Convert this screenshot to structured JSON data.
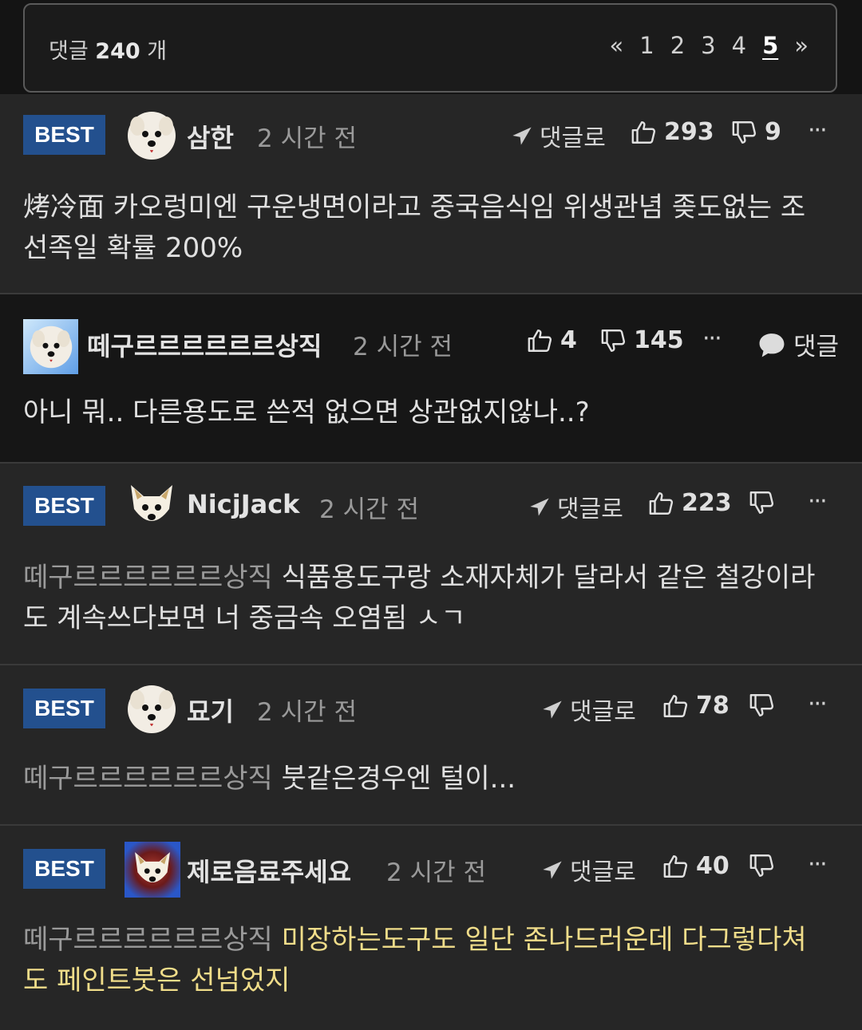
{
  "header": {
    "count_prefix": "댓글",
    "count_value": "240",
    "count_suffix": "개",
    "pager": {
      "prev": "«",
      "pages": [
        "1",
        "2",
        "3",
        "4",
        "5"
      ],
      "current": "5",
      "next": "»"
    }
  },
  "comments": [
    {
      "badge": "BEST",
      "username": "삼한",
      "time": "2 시간 전",
      "reply_label": "댓글로",
      "likes": "293",
      "dislikes": "9",
      "more": "···",
      "mention": "",
      "text": "烤冷面 카오렁미엔 구운냉면이라고 중국음식임 위생관념 좆도없는 조선족일 확률 200%"
    },
    {
      "username": "떼구르르르르르르상직",
      "time": "2 시간 전",
      "likes": "4",
      "dislikes": "145",
      "more": "···",
      "reply_label": "댓글",
      "text": "아니 뭐.. 다른용도로 쓴적 없으면 상관없지않나..?"
    },
    {
      "badge": "BEST",
      "username": "NicjJack",
      "time": "2 시간 전",
      "reply_label": "댓글로",
      "likes": "223",
      "dislikes": "",
      "more": "···",
      "mention": "떼구르르르르르르상직",
      "text": "식품용도구랑 소재자체가 달라서 같은 철강이라도 계속쓰다보면 너 중금속 오염됨 ㅅㄱ"
    },
    {
      "badge": "BEST",
      "username": "묘기",
      "time": "2 시간 전",
      "reply_label": "댓글로",
      "likes": "78",
      "dislikes": "",
      "more": "···",
      "mention": "떼구르르르르르르상직",
      "text": "붓같은경우엔 털이..."
    },
    {
      "badge": "BEST",
      "username": "제로음료주세요",
      "time": "2 시간 전",
      "reply_label": "댓글로",
      "likes": "40",
      "dislikes": "",
      "more": "···",
      "mention": "떼구르르르르르르상직",
      "text": "미장하는도구도 일단 존나드러운데 다그렇다쳐도 페인트붓은 선넘었지"
    }
  ],
  "colors": {
    "best_badge": "#23508e",
    "highlight_text": "#f0dd8a",
    "mention": "#9a9a9a"
  }
}
